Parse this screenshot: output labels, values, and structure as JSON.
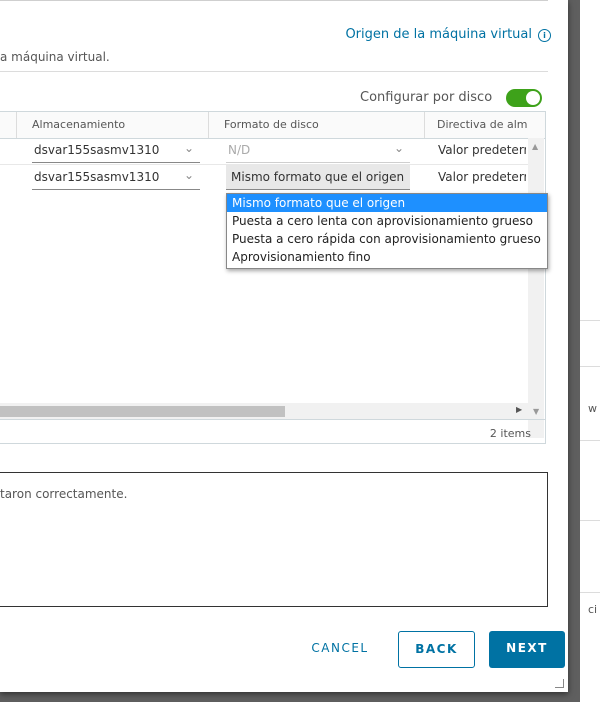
{
  "header": {
    "origin_link": "Origen de la máquina virtual",
    "info_glyph": "i",
    "description": "a máquina virtual."
  },
  "configure": {
    "label": "Configurar por disco",
    "toggle_on": true,
    "toggle_color": "#3ea21a"
  },
  "grid": {
    "columns": [
      "Almacenamiento",
      "Formato de disco",
      "Directiva de alm"
    ],
    "rows": [
      {
        "storage": "dsvar155sasmv1310",
        "format": "N/D",
        "policy": "Valor predeterr"
      },
      {
        "storage": "dsvar155sasmv1310",
        "format": "Mismo formato que el origen",
        "policy": "Valor predeterr"
      }
    ],
    "items_count": "2 items"
  },
  "format_dropdown": {
    "options": [
      "Mismo formato que el origen",
      "Puesta a cero lenta con aprovisionamiento grueso",
      "Puesta a cero rápida con aprovisionamiento grueso",
      "Aprovisionamiento fino"
    ],
    "highlight_color": "#1e90ff"
  },
  "status": {
    "message": "taron correctamente."
  },
  "footer": {
    "cancel": "CANCEL",
    "back": "BACK",
    "next": "NEXT"
  },
  "background": {
    "fragment_1": "w",
    "fragment_2": "ci"
  }
}
